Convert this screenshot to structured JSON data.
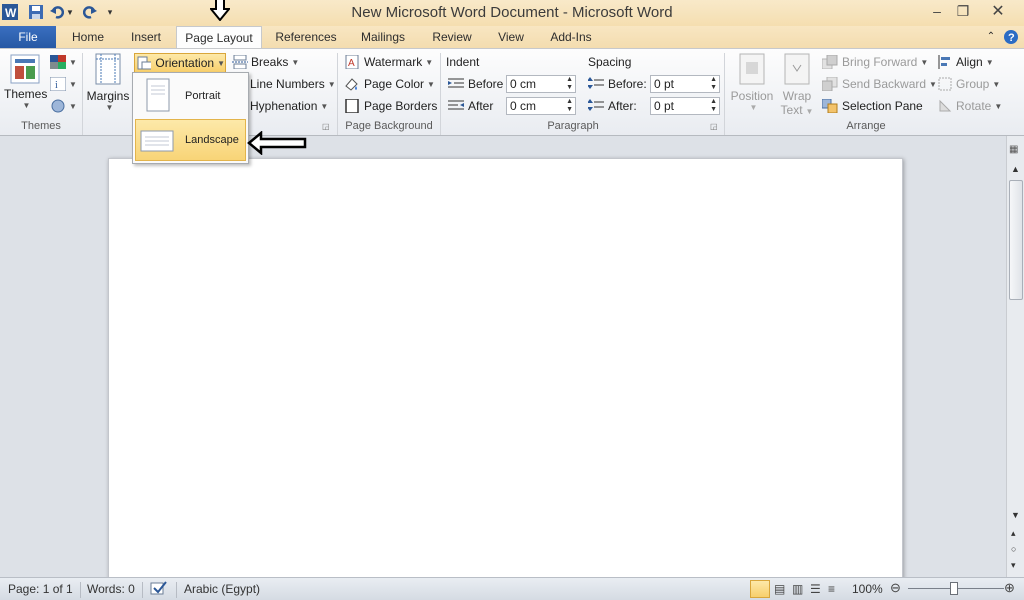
{
  "titlebar": {
    "title": "New Microsoft Word Document  -  Microsoft Word",
    "app_icon": "word-icon",
    "quick_access": [
      "save-icon",
      "undo-icon",
      "redo-icon",
      "customize-icon"
    ],
    "window_controls": [
      "minimize-icon",
      "restore-icon",
      "close-icon"
    ]
  },
  "tabs": [
    {
      "label": "File"
    },
    {
      "label": "Home"
    },
    {
      "label": "Insert"
    },
    {
      "label": "Page Layout"
    },
    {
      "label": "References"
    },
    {
      "label": "Mailings"
    },
    {
      "label": "Review"
    },
    {
      "label": "View"
    },
    {
      "label": "Add-Ins"
    }
  ],
  "ribbon": {
    "themes": {
      "label": "Themes",
      "group": "Themes"
    },
    "page_setup": {
      "margins": "Margins",
      "orientation": "Orientation",
      "breaks": "Breaks",
      "line_numbers": "Line Numbers",
      "hyphenation": "Hyphenation"
    },
    "page_background": {
      "group": "Page Background",
      "watermark": "Watermark",
      "page_color": "Page Color",
      "page_borders": "Page Borders"
    },
    "paragraph": {
      "group": "Paragraph",
      "indent_title": "Indent",
      "indent_before_label": "Before",
      "indent_before_value": "0 cm",
      "indent_after_label": "After",
      "indent_after_value": "0 cm",
      "spacing_title": "Spacing",
      "spacing_before_label": "Before:",
      "spacing_before_value": "0 pt",
      "spacing_after_label": "After:",
      "spacing_after_value": "0 pt"
    },
    "arrange": {
      "group": "Arrange",
      "position": "Position",
      "wrap_text_1": "Wrap",
      "wrap_text_2": "Text",
      "bring_forward": "Bring Forward",
      "send_backward": "Send Backward",
      "selection_pane": "Selection Pane",
      "align": "Align",
      "group_btn": "Group",
      "rotate": "Rotate"
    }
  },
  "orientation_menu": {
    "items": [
      {
        "label": "Portrait"
      },
      {
        "label": "Landscape"
      }
    ]
  },
  "status": {
    "page": "Page: 1 of 1",
    "words": "Words: 0",
    "language": "Arabic (Egypt)",
    "zoom": "100%"
  }
}
